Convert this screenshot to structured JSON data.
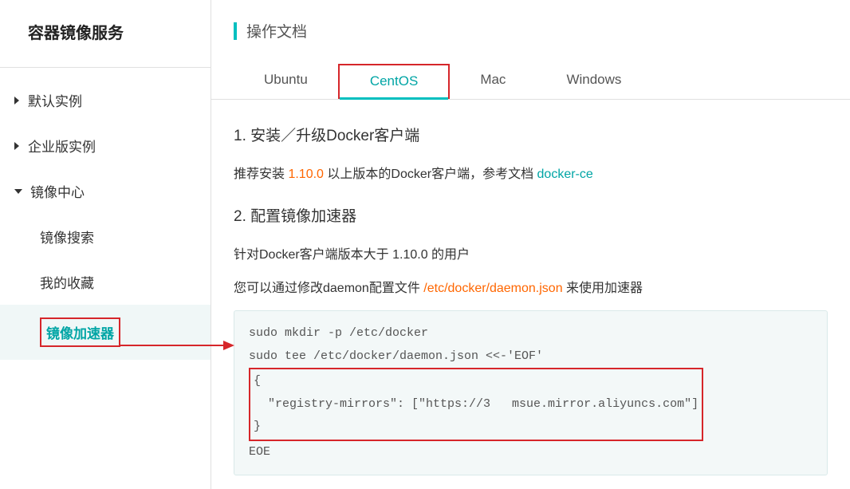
{
  "sidebar": {
    "title": "容器镜像服务",
    "items": [
      {
        "label": "默认实例",
        "expanded": false
      },
      {
        "label": "企业版实例",
        "expanded": false
      },
      {
        "label": "镜像中心",
        "expanded": true
      }
    ],
    "subItems": [
      {
        "label": "镜像搜索",
        "active": false
      },
      {
        "label": "我的收藏",
        "active": false
      },
      {
        "label": "镜像加速器",
        "active": true
      }
    ]
  },
  "header": {
    "title": "操作文档"
  },
  "tabs": [
    {
      "label": "Ubuntu",
      "active": false
    },
    {
      "label": "CentOS",
      "active": true
    },
    {
      "label": "Mac",
      "active": false
    },
    {
      "label": "Windows",
      "active": false
    }
  ],
  "section1": {
    "title": "1. 安装／升级Docker客户端",
    "textPrefix": "推荐安装 ",
    "version": "1.10.0",
    "textMid": " 以上版本的Docker客户端，参考文档 ",
    "link": "docker-ce"
  },
  "section2": {
    "title": "2. 配置镜像加速器",
    "line1": "针对Docker客户端版本大于 1.10.0 的用户",
    "line2a": "您可以通过修改daemon配置文件 ",
    "line2path": "/etc/docker/daemon.json",
    "line2b": " 来使用加速器"
  },
  "code": {
    "line1": "sudo mkdir -p /etc/docker",
    "line2": "sudo tee /etc/docker/daemon.json <<-'EOF'",
    "line3": "{",
    "line4": "  \"registry-mirrors\": [\"https://3   msue.mirror.aliyuncs.com\"]",
    "line5": "}",
    "line6": "EOE"
  }
}
